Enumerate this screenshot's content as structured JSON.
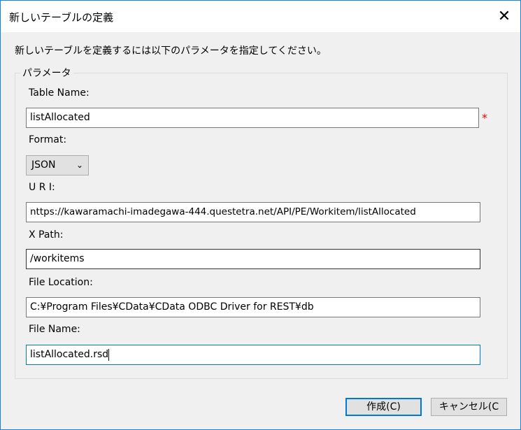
{
  "window": {
    "title": "新しいテーブルの定義",
    "close": "✕"
  },
  "instruction": "新しいテーブルを定義するには以下のパラメータを指定してください。",
  "group_label": "パラメータ",
  "fields": {
    "table_name": {
      "label": "Table Name:",
      "value": "listAllocated",
      "required_mark": "*"
    },
    "format": {
      "label": "Format:",
      "value": "JSON"
    },
    "uri": {
      "label": "U R I:",
      "value": "nttps://kawaramachi-imadegawa-444.questetra.net/API/PE/Workitem/listAllocated"
    },
    "xpath": {
      "label": "X Path:",
      "value": "/workitems"
    },
    "file_location": {
      "label": "File Location:",
      "value": "C:¥Program Files¥CData¥CData ODBC Driver for REST¥db"
    },
    "file_name": {
      "label": "File Name:",
      "value": "listAllocated.rsd"
    }
  },
  "buttons": {
    "create": "作成(C)",
    "cancel": "キャンセル(C"
  }
}
